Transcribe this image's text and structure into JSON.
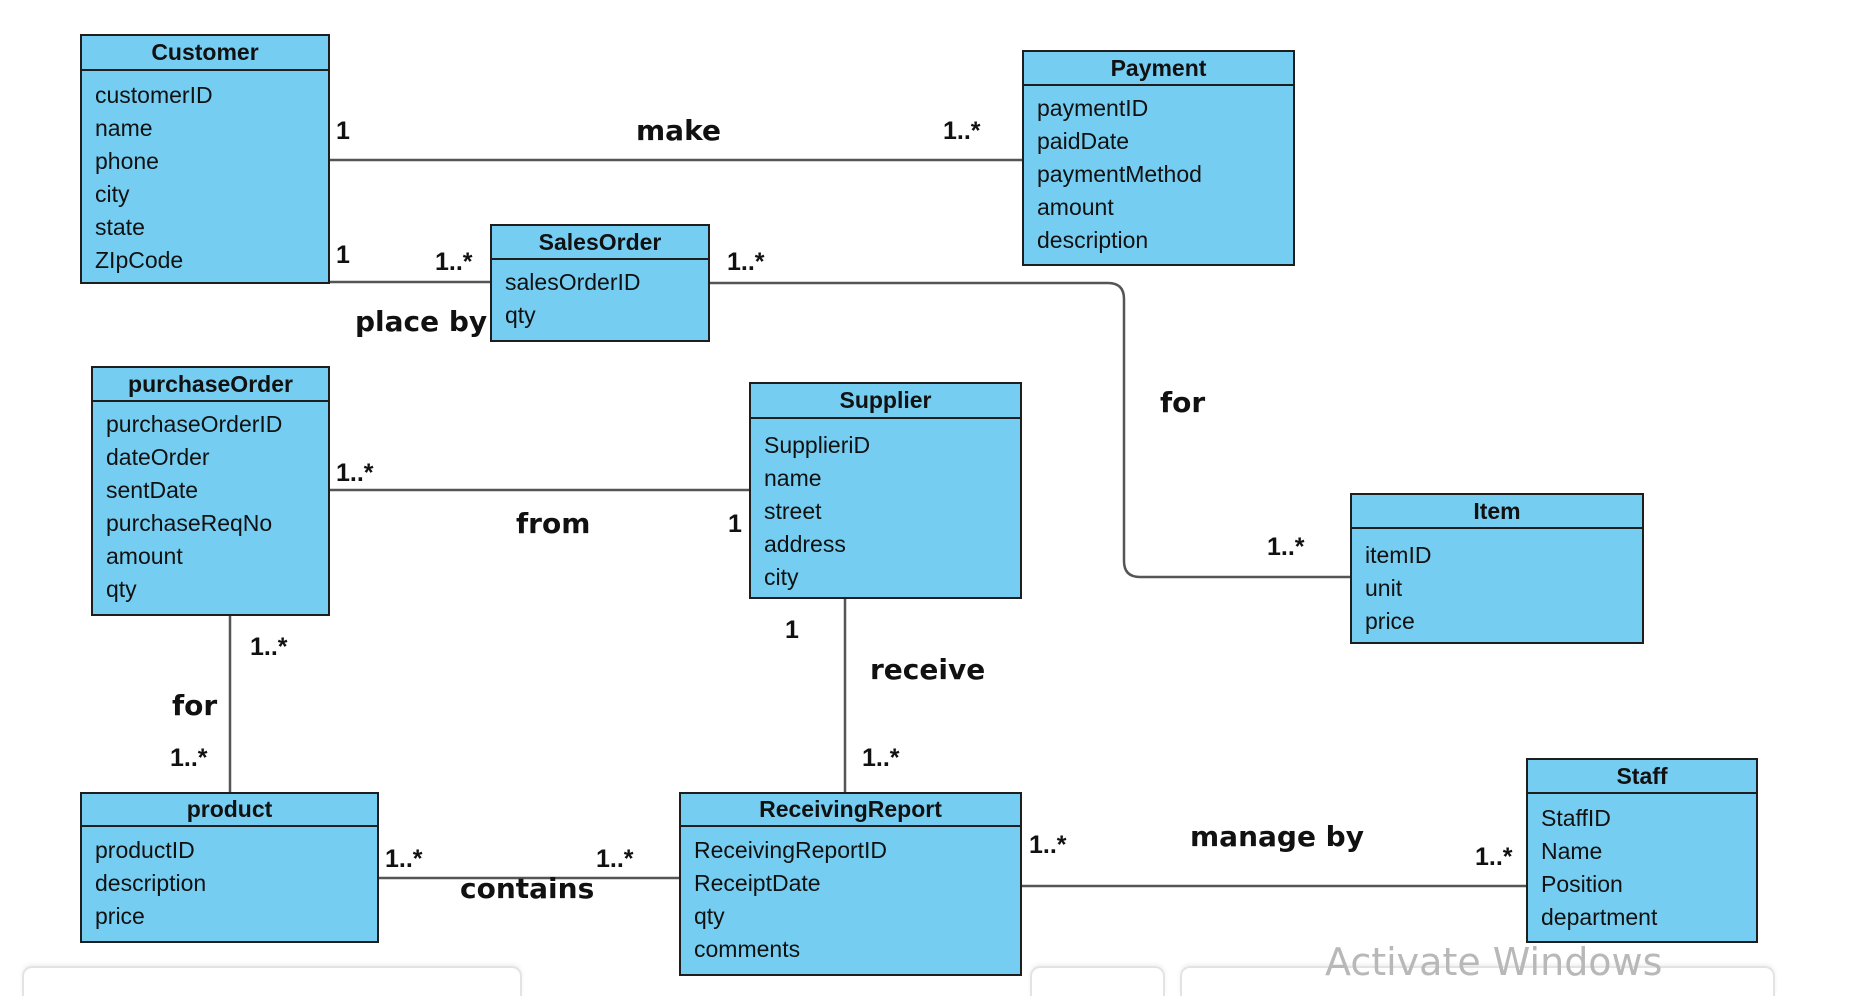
{
  "diagram": {
    "type": "UML class diagram",
    "colors": {
      "class_fill": "#75cef2",
      "class_border": "#1e1e1e",
      "line": "#555555"
    },
    "classes": {
      "customer": {
        "name": "Customer",
        "attributes": [
          "customerID",
          "name",
          "phone",
          "city",
          "state",
          "ZIpCode"
        ]
      },
      "payment": {
        "name": "Payment",
        "attributes": [
          "paymentID",
          "paidDate",
          "paymentMethod",
          "amount",
          "description"
        ]
      },
      "salesOrder": {
        "name": "SalesOrder",
        "attributes": [
          "salesOrderID",
          "qty"
        ]
      },
      "purchaseOrder": {
        "name": "purchaseOrder",
        "attributes": [
          "purchaseOrderID",
          "dateOrder",
          "sentDate",
          "purchaseReqNo",
          "amount",
          "qty"
        ]
      },
      "supplier": {
        "name": "Supplier",
        "attributes": [
          "SupplieriD",
          "name",
          "street",
          "address",
          "city"
        ]
      },
      "item": {
        "name": "Item",
        "attributes": [
          "itemID",
          "unit",
          "price"
        ]
      },
      "product": {
        "name": "product",
        "attributes": [
          "productID",
          "description",
          "price"
        ]
      },
      "receivingReport": {
        "name": "ReceivingReport",
        "attributes": [
          "ReceivingReportID",
          "ReceiptDate",
          "qty",
          "comments"
        ]
      },
      "staff": {
        "name": "Staff",
        "attributes": [
          "StaffID",
          "Name",
          "Position",
          "department"
        ]
      }
    },
    "relationships": {
      "make": {
        "label": "make",
        "from": "Customer",
        "to": "Payment",
        "from_mult": "1",
        "to_mult": "1..*"
      },
      "placeBy": {
        "label": "place by",
        "from": "Customer",
        "to": "SalesOrder",
        "from_mult": "1",
        "to_mult": "1..*"
      },
      "forItem": {
        "label": "for",
        "from": "SalesOrder",
        "to": "Item",
        "from_mult": "1..*",
        "to_mult": "1..*"
      },
      "from": {
        "label": "from",
        "from": "purchaseOrder",
        "to": "Supplier",
        "from_mult": "1..*",
        "to_mult": "1"
      },
      "forProduct": {
        "label": "for",
        "from": "purchaseOrder",
        "to": "product",
        "from_mult": "1..*",
        "to_mult": "1..*"
      },
      "receive": {
        "label": "receive",
        "from": "Supplier",
        "to": "ReceivingReport",
        "from_mult": "1",
        "to_mult": "1..*"
      },
      "contains": {
        "label": "contains",
        "from": "product",
        "to": "ReceivingReport",
        "from_mult": "1..*",
        "to_mult": "1..*"
      },
      "manageBy": {
        "label": "manage by",
        "from": "ReceivingReport",
        "to": "Staff",
        "from_mult": "1..*",
        "to_mult": "1..*"
      }
    }
  },
  "watermark": "Activate Windows"
}
